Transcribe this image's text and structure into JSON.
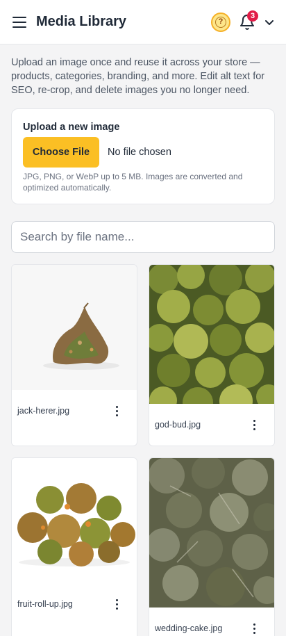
{
  "header": {
    "menu_icon": "hamburger-icon",
    "title": "Media Library",
    "help_icon": "question-circle-icon",
    "help_glyph": "?",
    "bell_icon": "bell-icon",
    "notification_count": "3",
    "account_icon": "chevron-down-icon",
    "accent_color": "#fbbf24",
    "badge_color": "#e11d48"
  },
  "intro": "Upload an image once and reuse it across your store — products, categories, branding, and more. Edit alt text for SEO, re-crop, and delete images you no longer need.",
  "upload": {
    "title": "Upload a new image",
    "button_label": "Choose File",
    "file_status": "No file chosen",
    "hint": "JPG, PNG, or WebP up to 5 MB. Images are converted and optimized automatically."
  },
  "search": {
    "placeholder": "Search by file name...",
    "value": ""
  },
  "images": [
    {
      "filename": "jack-herer.jpg",
      "menu_icon": "more-vertical-icon"
    },
    {
      "filename": "god-bud.jpg",
      "menu_icon": "more-vertical-icon"
    },
    {
      "filename": "fruit-roll-up.jpg",
      "menu_icon": "more-vertical-icon"
    },
    {
      "filename": "wedding-cake.jpg",
      "menu_icon": "more-vertical-icon"
    }
  ]
}
